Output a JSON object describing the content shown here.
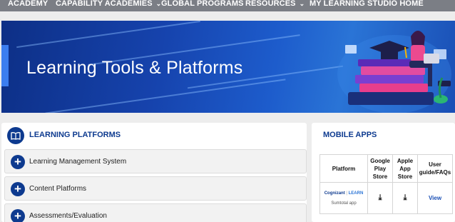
{
  "nav": {
    "items": [
      {
        "label": "ACADEMY"
      },
      {
        "label": "CAPABILITY ACADEMIES"
      },
      {
        "label": "GLOBAL PROGRAMS"
      },
      {
        "label": "RESOURCES"
      },
      {
        "label": "MY LEARNING STUDIO HOME"
      }
    ]
  },
  "banner": {
    "title": "Learning Tools & Platforms"
  },
  "learning_platforms": {
    "title": "LEARNING PLATFORMS",
    "icon": "book-icon",
    "items": [
      {
        "label": "Learning Management System"
      },
      {
        "label": "Content Platforms"
      },
      {
        "label": "Assessments/Evaluation"
      }
    ]
  },
  "mobile_apps": {
    "title": "MOBILE APPS",
    "headers": [
      "Platform",
      "Google Play Store",
      "Apple App Store",
      "User guide/FAQs"
    ],
    "rows": [
      {
        "brand": "Cognizant",
        "brand_suffix": "LEARN",
        "app": "Sumtotal app",
        "view": "View"
      }
    ]
  },
  "colors": {
    "nav_bg": "#7b7e85",
    "brand_blue": "#0d3a8f",
    "banner_blue": "#1643ad"
  }
}
